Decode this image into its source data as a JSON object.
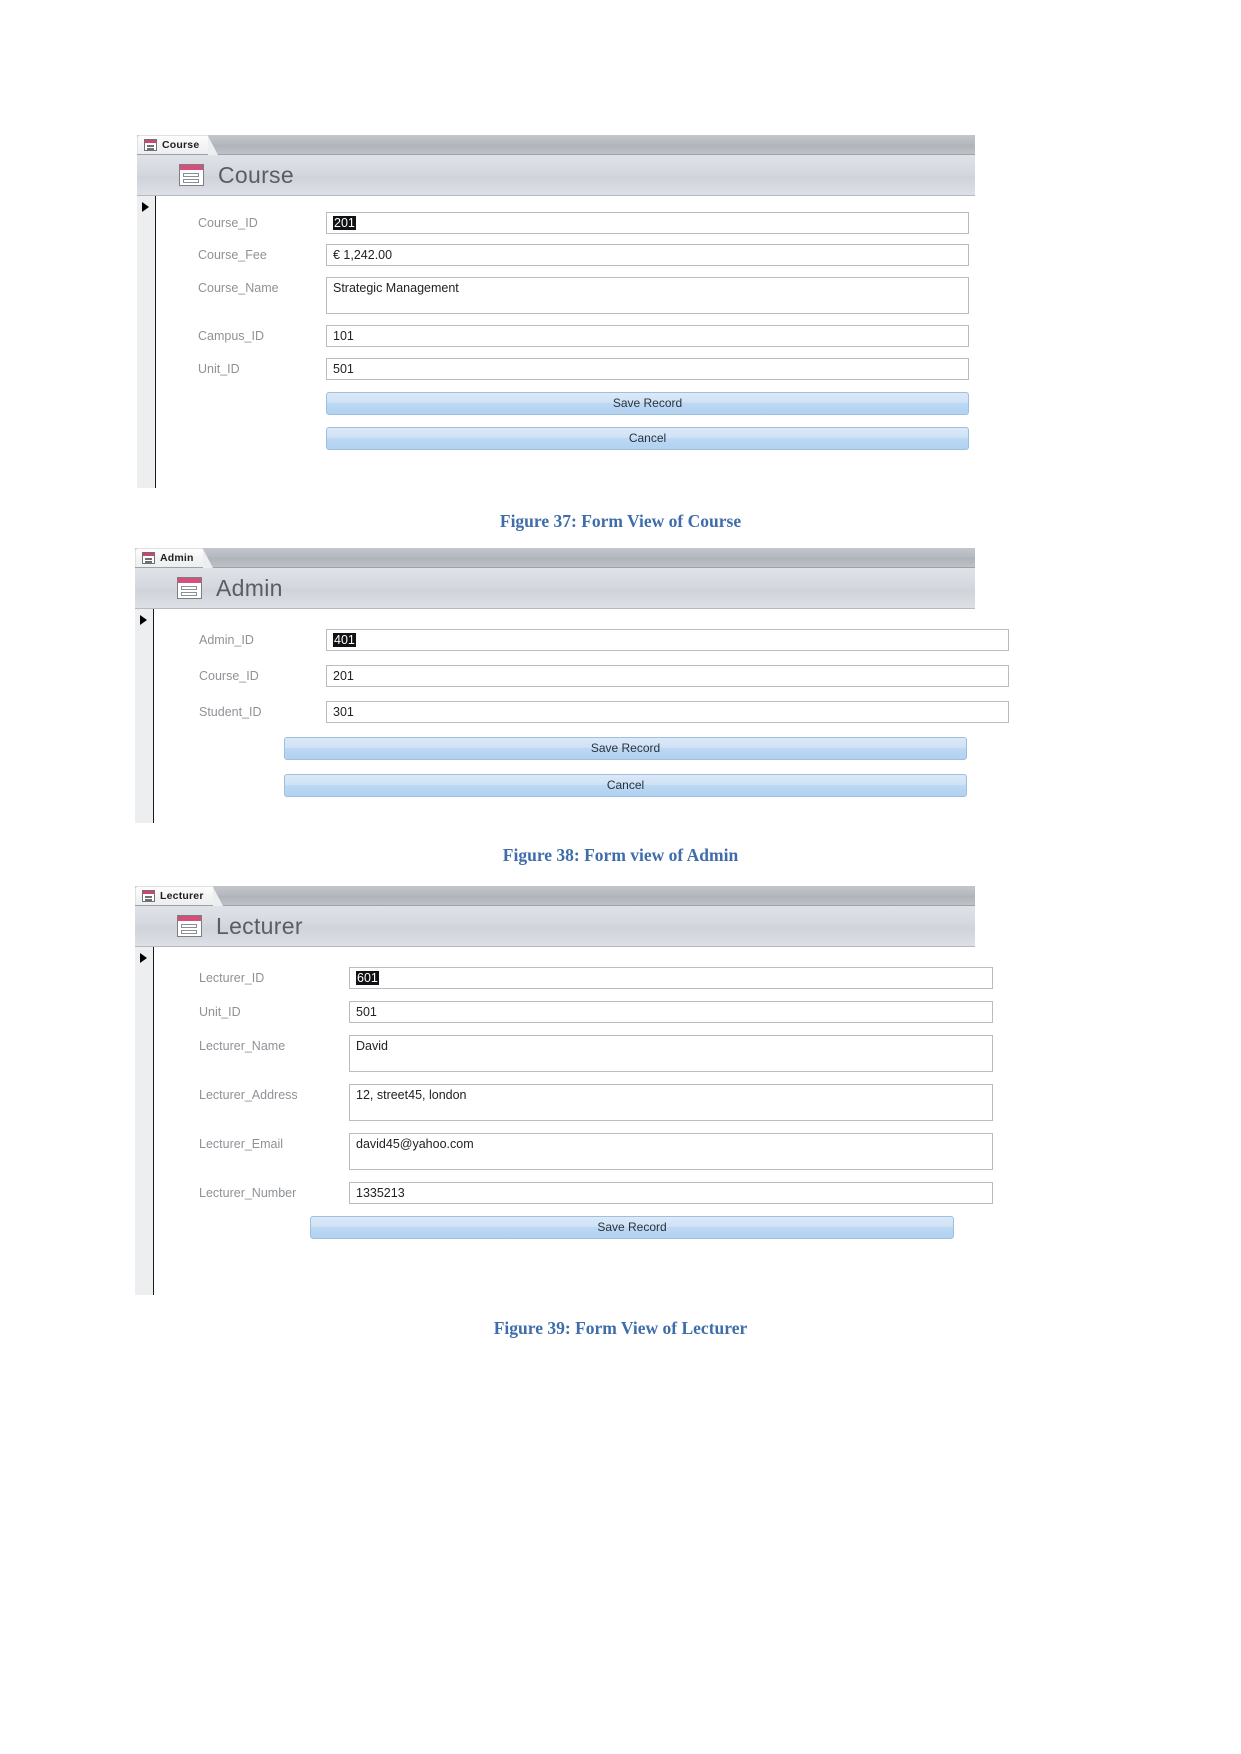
{
  "document": {
    "figures": [
      {
        "id": "course",
        "tab_label": "Course",
        "title": "Course",
        "tab_icon": "form-icon",
        "header_icon": "form-icon",
        "fields": [
          {
            "label": "Course_ID",
            "value": "201",
            "selected": true,
            "tall": false
          },
          {
            "label": "Course_Fee",
            "value": "€ 1,242.00",
            "selected": false,
            "tall": false
          },
          {
            "label": "Course_Name",
            "value": "Strategic Management",
            "selected": false,
            "tall": true
          },
          {
            "label": "Campus_ID",
            "value": "101",
            "selected": false,
            "tall": false
          },
          {
            "label": "Unit_ID",
            "value": "501",
            "selected": false,
            "tall": false
          }
        ],
        "buttons": [
          {
            "label": "Save Record"
          },
          {
            "label": "Cancel"
          }
        ],
        "caption": "Figure 37: Form View of Course"
      },
      {
        "id": "admin",
        "tab_label": "Admin",
        "title": "Admin",
        "tab_icon": "form-icon",
        "header_icon": "form-icon",
        "fields": [
          {
            "label": "Admin_ID",
            "value": "401",
            "selected": true,
            "tall": false
          },
          {
            "label": "Course_ID",
            "value": "201",
            "selected": false,
            "tall": false
          },
          {
            "label": "Student_ID",
            "value": "301",
            "selected": false,
            "tall": false
          }
        ],
        "buttons": [
          {
            "label": "Save Record"
          },
          {
            "label": "Cancel"
          }
        ],
        "caption": "Figure 38: Form view of Admin"
      },
      {
        "id": "lecturer",
        "tab_label": "Lecturer",
        "title": "Lecturer",
        "tab_icon": "form-icon",
        "header_icon": "form-icon",
        "fields": [
          {
            "label": "Lecturer_ID",
            "value": "601",
            "selected": true,
            "tall": false
          },
          {
            "label": "Unit_ID",
            "value": "501",
            "selected": false,
            "tall": false
          },
          {
            "label": "Lecturer_Name",
            "value": "David",
            "selected": false,
            "tall": true
          },
          {
            "label": "Lecturer_Address",
            "value": "12, street45, london",
            "selected": false,
            "tall": true
          },
          {
            "label": "Lecturer_Email",
            "value": "david45@yahoo.com",
            "selected": false,
            "tall": true
          },
          {
            "label": "Lecturer_Number",
            "value": "1335213",
            "selected": false,
            "tall": false
          }
        ],
        "buttons": [
          {
            "label": "Save Record"
          }
        ],
        "caption": "Figure 39: Form View of Lecturer"
      }
    ]
  }
}
